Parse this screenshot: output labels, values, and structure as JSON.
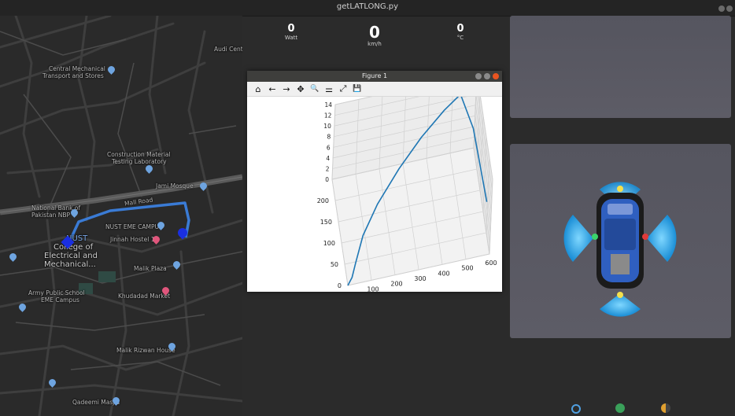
{
  "window": {
    "title": "getLATLONG.py"
  },
  "gauges": [
    {
      "value": "0",
      "unit": "Watt"
    },
    {
      "value": "0",
      "unit": "km/h"
    },
    {
      "value": "0",
      "unit": "°C"
    }
  ],
  "map": {
    "labels": [
      "Central Mechanical",
      "Transport and Stores",
      "Construction Material",
      "Testing Laboratory",
      "National Bank of",
      "Pakistan NBP",
      "NUST EME CAMPUS",
      "Jinnah Hostel 1",
      "NUST",
      "College of",
      "Electrical and",
      "Mechanical...",
      "Malik Plaza",
      "Army Public School",
      "EME Campus",
      "Khudadad Market",
      "Malik Rizwan House",
      "Qadeemi Masjid",
      "Jami Mosque",
      "Audi Centre",
      "Mall Road"
    ]
  },
  "figure": {
    "title": "Figure 1",
    "toolbar": [
      "home-icon",
      "back-icon",
      "forward-icon",
      "pan-icon",
      "zoom-icon",
      "configure-subplots-icon",
      "edit-axis-icon",
      "save-icon"
    ],
    "toolbar_glyphs": [
      "⌂",
      "←",
      "→",
      "✥",
      "🔍",
      "⚌",
      "⤢",
      "💾"
    ]
  },
  "chart_data": {
    "type": "line",
    "projection": "3d",
    "title": "",
    "xlabel": "",
    "ylabel": "",
    "zlabel": "",
    "x_ticks": [
      "0",
      "100",
      "200",
      "300",
      "400",
      "500",
      "600"
    ],
    "y_ticks": [
      "0",
      "50",
      "100",
      "150",
      "200"
    ],
    "z_ticks": [
      "0",
      "2",
      "4",
      "6",
      "8",
      "10",
      "12",
      "14"
    ],
    "xlim": [
      0,
      600
    ],
    "ylim": [
      0,
      250
    ],
    "zlim": [
      0,
      14
    ],
    "grid": true,
    "series": [
      {
        "color": "#1f77b4",
        "x": [
          0,
          20,
          40,
          80,
          150,
          250,
          350,
          450,
          520,
          560,
          600
        ],
        "y": [
          0,
          10,
          30,
          70,
          110,
          150,
          180,
          200,
          210,
          150,
          60
        ],
        "z": [
          0,
          0.5,
          1.5,
          3,
          5,
          7.5,
          10,
          12.5,
          14,
          12,
          5
        ]
      }
    ]
  },
  "sensors": {
    "front": "yellow",
    "rear": "yellow",
    "left": "green",
    "right": "red"
  },
  "colors": {
    "route": "#3a7bd5",
    "sensor_wave": "#2aa8e6",
    "car_body": "#2f5fc0"
  }
}
